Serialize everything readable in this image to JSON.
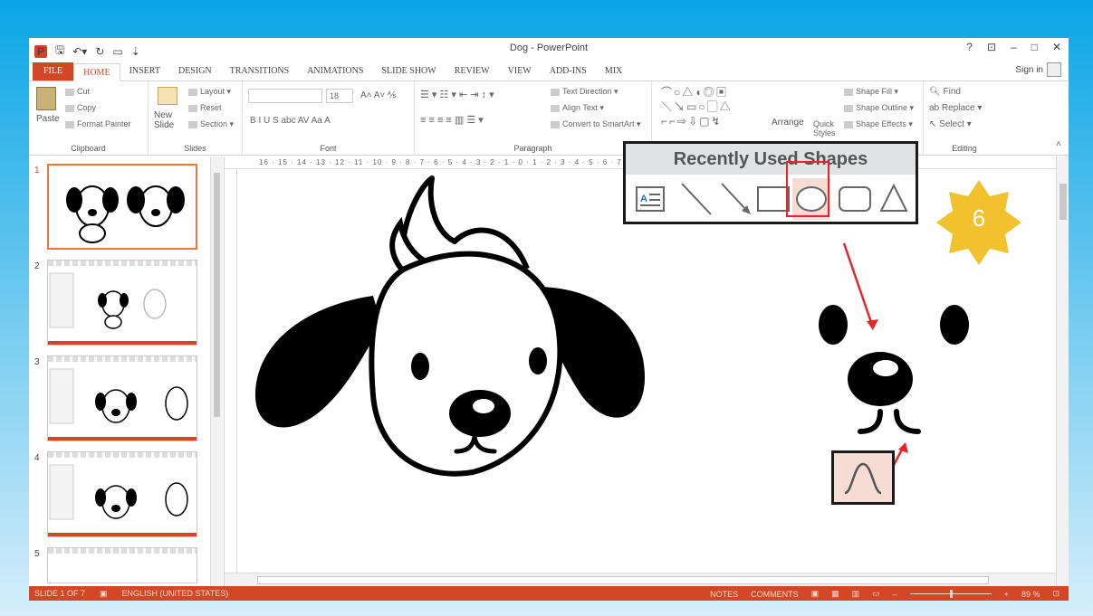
{
  "window": {
    "title": "Dog - PowerPoint",
    "app_icon": "powerpoint-icon",
    "controls": [
      "?",
      "⊡",
      "–",
      "□",
      "✕"
    ]
  },
  "tabs": [
    "FILE",
    "HOME",
    "INSERT",
    "DESIGN",
    "TRANSITIONS",
    "ANIMATIONS",
    "SLIDE SHOW",
    "REVIEW",
    "VIEW",
    "ADD-INS",
    "MIX"
  ],
  "active_tab": "HOME",
  "sign_in": "Sign in",
  "ribbon": {
    "clipboard": {
      "label": "Clipboard",
      "paste": "Paste",
      "cut": "Cut",
      "copy": "Copy",
      "format_painter": "Format Painter"
    },
    "slides": {
      "label": "Slides",
      "new_slide": "New Slide",
      "layout": "Layout",
      "reset": "Reset",
      "section": "Section"
    },
    "font": {
      "label": "Font",
      "size": "18",
      "buttons": "B  I  U  S  abc  AV  Aa  A"
    },
    "paragraph": {
      "label": "Paragraph",
      "text_direction": "Text Direction",
      "align_text": "Align Text",
      "convert_smartart": "Convert to SmartArt"
    },
    "drawing": {
      "arrange": "Arrange",
      "quick_styles": "Quick Styles",
      "shape_fill": "Shape Fill",
      "shape_outline": "Shape Outline",
      "shape_effects": "Shape Effects"
    },
    "editing": {
      "label": "Editing",
      "find": "Find",
      "replace": "Replace",
      "select": "Select"
    }
  },
  "ruler": {
    "marks": "16 · 15 · 14 · 13 · 12 · 11 · 10 · 9 · 8 · 7 · 6 · 5 · 4 · 3 · 2 · 1 · 0 · 1 · 2 · 3 · 4 · 5 · 6 · 7 · 8 · 9 · 10 · 11 · 12 · 13 · 14"
  },
  "slides_panel": {
    "numbers": [
      "1",
      "2",
      "3",
      "4",
      "5"
    ],
    "selected": "1"
  },
  "callout": {
    "recently_used_title": "Recently Used Shapes",
    "shapes": [
      "text-box-icon",
      "line-icon",
      "arrow-icon",
      "rectangle-icon",
      "oval-icon",
      "rounded-rectangle-icon",
      "triangle-icon"
    ],
    "highlighted_shape": "oval-icon",
    "step_number": "6",
    "curve_shape": "curve-icon"
  },
  "status_bar": {
    "slide_info": "SLIDE 1 OF 7",
    "language": "ENGLISH (UNITED STATES)",
    "notes": "NOTES",
    "comments": "COMMENTS",
    "zoom": "89 %"
  },
  "colors": {
    "accent": "#d24726",
    "highlight": "#e4262a",
    "badge": "#f2c12e",
    "background": "#0aa6e6"
  }
}
